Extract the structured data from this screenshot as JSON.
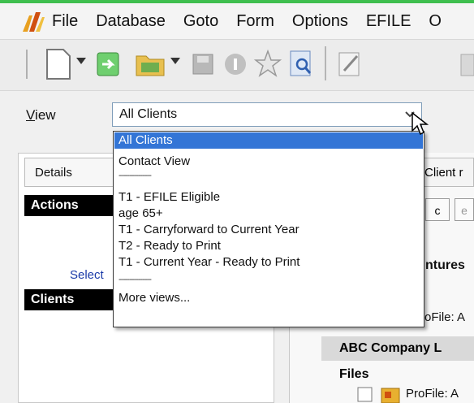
{
  "menu": {
    "items": [
      "File",
      "Database",
      "Goto",
      "Form",
      "Options",
      "EFILE",
      "O"
    ]
  },
  "toolbar": {
    "icons": [
      "new-document-icon",
      "dropdown-arrow-icon",
      "open-green-icon",
      "folder-icon",
      "dropdown-arrow-icon",
      "save-icon",
      "info-icon",
      "star-icon",
      "preview-icon",
      "edit-icon"
    ]
  },
  "view": {
    "label_prefix": "V",
    "label_rest": "iew",
    "selected": "All Clients"
  },
  "dropdown": {
    "items": [
      {
        "label": "All Clients",
        "selected": true
      },
      {
        "label": "Contact View"
      },
      {
        "label": "---------------",
        "separator": true
      },
      {
        "label": "T1 - EFILE Eligible"
      },
      {
        "label": "age 65+"
      },
      {
        "label": "T1 - Carryforward to Current Year"
      },
      {
        "label": "T2 - Ready to Print"
      },
      {
        "label": "T1 - Current Year - Ready to Print"
      },
      {
        "label": "---------------",
        "separator": true
      },
      {
        "label": "More views..."
      }
    ]
  },
  "left_panel": {
    "tab_details": "Details",
    "actions": "Actions",
    "select_link": "Select",
    "clients": "Clients"
  },
  "right_panel": {
    "tab": "Client r",
    "small_c": "c",
    "small_e": "e",
    "fragment_ntures": "ntures",
    "fragment_profile1": "oFile: A",
    "abc_company": "ABC Company L",
    "files": "Files",
    "fragment_profile2": "ProFile: A"
  },
  "colors": {
    "selection": "#3375d6",
    "link": "#1a3aa8",
    "top_accent": "#3fbf4f"
  }
}
